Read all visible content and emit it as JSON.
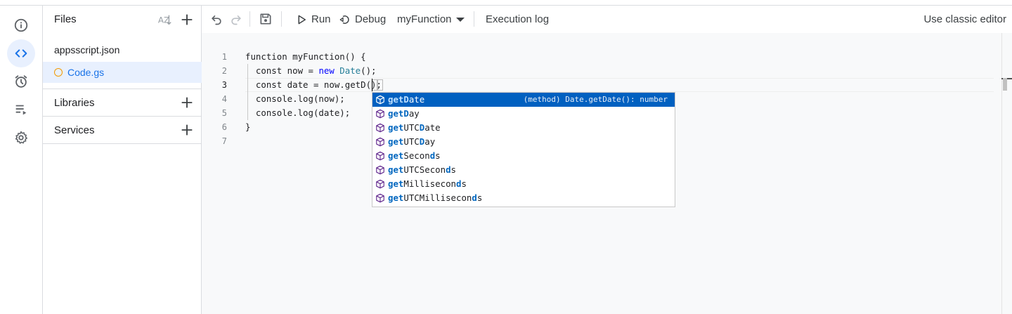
{
  "files_panel": {
    "title": "Files",
    "files": [
      {
        "name": "appsscript.json",
        "active": false
      },
      {
        "name": "Code.gs",
        "active": true
      }
    ],
    "sections": [
      "Libraries",
      "Services"
    ]
  },
  "toolbar": {
    "run_label": "Run",
    "debug_label": "Debug",
    "function_select": "myFunction",
    "execution_log_label": "Execution log",
    "classic_editor_label": "Use classic editor"
  },
  "editor": {
    "line_numbers": [
      "1",
      "2",
      "3",
      "4",
      "5",
      "6",
      "7"
    ],
    "current_line": "3",
    "lines": [
      [
        {
          "t": "function myFunction() {",
          "k": ""
        }
      ],
      [
        {
          "t": "  const now = ",
          "k": ""
        },
        {
          "t": "new",
          "k": "kw"
        },
        {
          "t": " ",
          "k": ""
        },
        {
          "t": "Date",
          "k": "cls"
        },
        {
          "t": "();",
          "k": ""
        }
      ],
      [
        {
          "t": "  const date = now.getD();",
          "k": ""
        }
      ],
      [
        {
          "t": "  console.log(now);",
          "k": ""
        }
      ],
      [
        {
          "t": "  console.log(date);",
          "k": ""
        }
      ],
      [
        {
          "t": "}",
          "k": ""
        }
      ],
      [
        {
          "t": "",
          "k": ""
        }
      ]
    ]
  },
  "autocomplete": {
    "items": [
      {
        "label": "getDate",
        "parts": [
          [
            "getD",
            1
          ],
          [
            "ate",
            0
          ]
        ],
        "detail": "(method) Date.getDate(): number",
        "selected": true
      },
      {
        "label": "getDay",
        "parts": [
          [
            "getD",
            1
          ],
          [
            "ay",
            0
          ]
        ],
        "selected": false
      },
      {
        "label": "getUTCDate",
        "parts": [
          [
            "get",
            1
          ],
          [
            "UTC",
            0
          ],
          [
            "D",
            1
          ],
          [
            "ate",
            0
          ]
        ],
        "selected": false
      },
      {
        "label": "getUTCDay",
        "parts": [
          [
            "get",
            1
          ],
          [
            "UTC",
            0
          ],
          [
            "D",
            1
          ],
          [
            "ay",
            0
          ]
        ],
        "selected": false
      },
      {
        "label": "getSeconds",
        "parts": [
          [
            "get",
            1
          ],
          [
            "Secon",
            0
          ],
          [
            "d",
            1
          ],
          [
            "s",
            0
          ]
        ],
        "selected": false
      },
      {
        "label": "getUTCSeconds",
        "parts": [
          [
            "get",
            1
          ],
          [
            "UTCSecon",
            0
          ],
          [
            "d",
            1
          ],
          [
            "s",
            0
          ]
        ],
        "selected": false
      },
      {
        "label": "getMilliseconds",
        "parts": [
          [
            "get",
            1
          ],
          [
            "Millisecon",
            0
          ],
          [
            "d",
            1
          ],
          [
            "s",
            0
          ]
        ],
        "selected": false
      },
      {
        "label": "getUTCMilliseconds",
        "parts": [
          [
            "get",
            1
          ],
          [
            "UTCMillisecon",
            0
          ],
          [
            "d",
            1
          ],
          [
            "s",
            0
          ]
        ],
        "selected": false
      }
    ]
  },
  "icons": {
    "rail": [
      "info-icon",
      "code-icon",
      "alarm-clock-icon",
      "executions-icon",
      "settings-gear-icon"
    ],
    "toolbar": [
      "undo-icon",
      "redo-icon",
      "save-icon",
      "play-icon",
      "debug-icon",
      "chevron-down-icon"
    ],
    "suggest_item": "method-cube-icon"
  },
  "colors": {
    "accent": "#1a73e8",
    "active_bg": "#e8f0fe",
    "selected_suggestion": "#0060c0",
    "keyword": "#0000ff",
    "class_name": "#267f99",
    "file_status": "#f29900",
    "method_icon": "#652d90"
  }
}
